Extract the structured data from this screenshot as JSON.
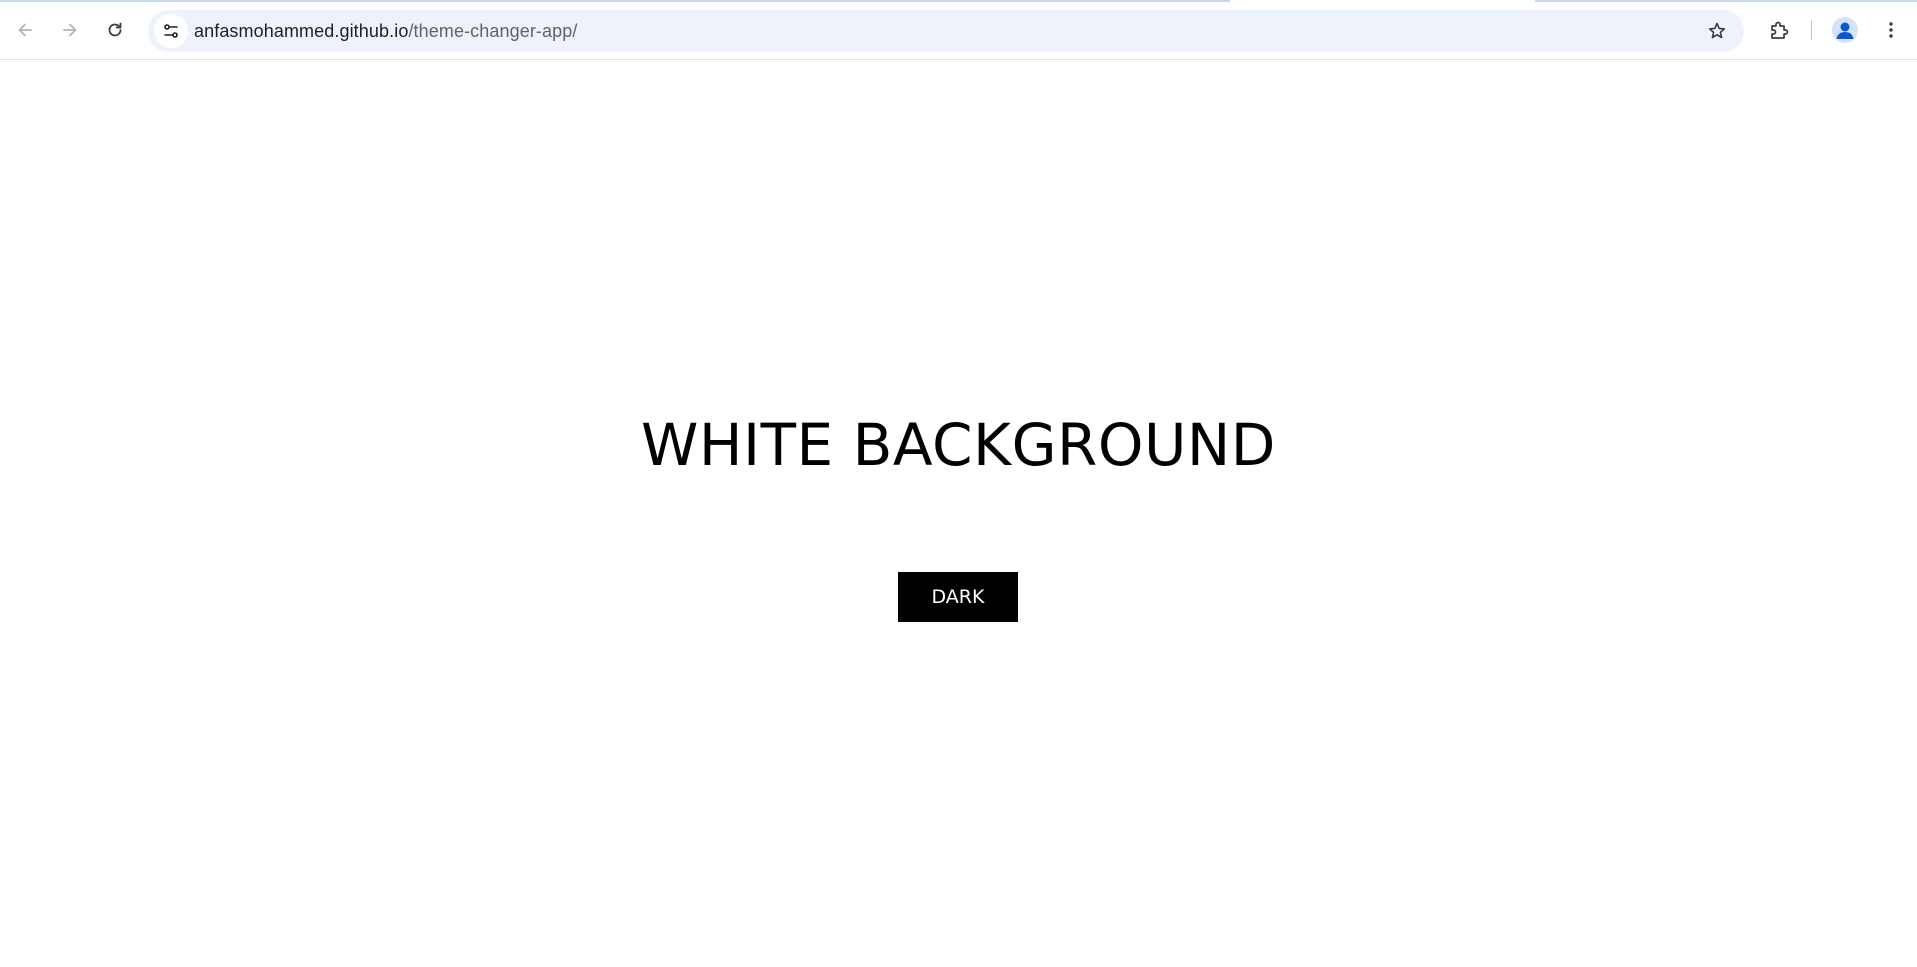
{
  "browser": {
    "url": {
      "domain": "anfasmohammed.github.io",
      "path": "/theme-changer-app/"
    },
    "icons": {
      "back": "arrow-left-icon",
      "forward": "arrow-right-icon",
      "reload": "reload-icon",
      "site_info": "tune-icon",
      "bookmark": "star-icon",
      "extensions": "puzzle-icon",
      "profile": "person-icon",
      "menu": "kebab-menu-icon"
    },
    "accent_color": "#0b57d0"
  },
  "page": {
    "heading": "WHITE BACKGROUND",
    "button_label": "DARK",
    "background_color": "#ffffff",
    "text_color": "#000000",
    "button_color": "#000000",
    "button_text_color": "#ffffff"
  }
}
